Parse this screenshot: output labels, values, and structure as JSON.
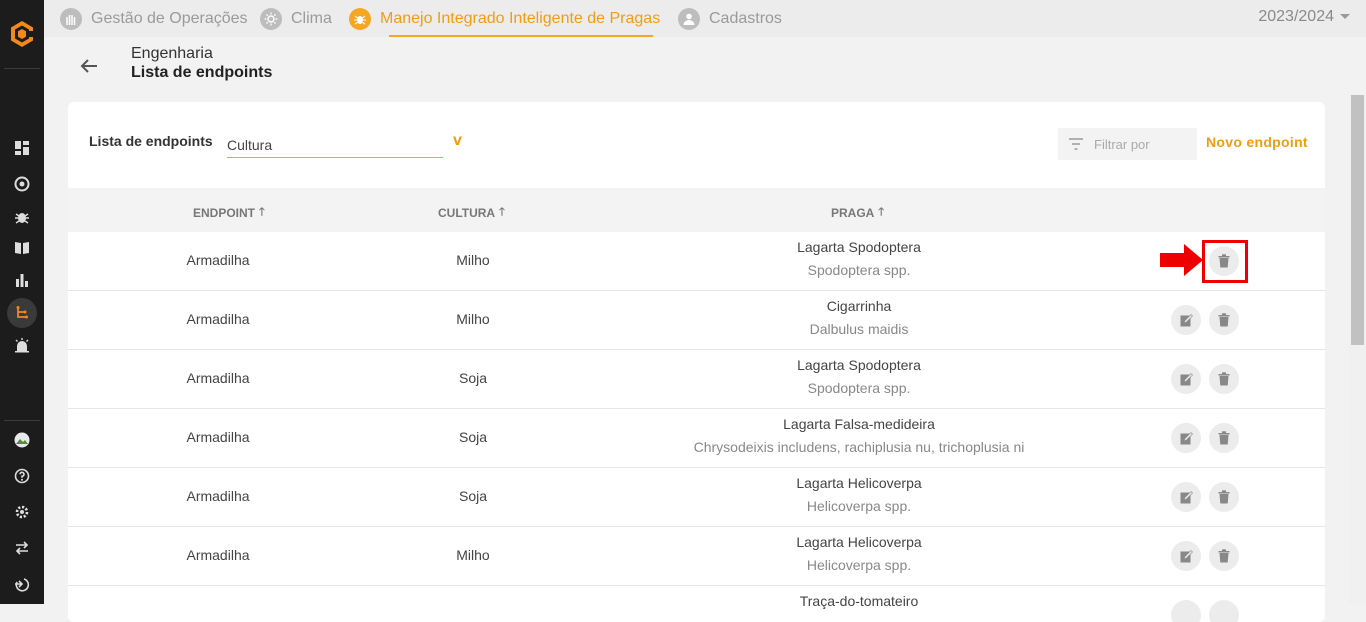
{
  "topbar": {
    "tabs": [
      {
        "label": "Gestão de Operações",
        "icon": "hand-icon"
      },
      {
        "label": "Clima",
        "icon": "sun-icon"
      },
      {
        "label": "Manejo Integrado Inteligente de Pragas",
        "icon": "bug-icon"
      },
      {
        "label": "Cadastros",
        "icon": "user-icon"
      }
    ],
    "season": "2023/2024"
  },
  "header": {
    "breadcrumb_parent": "Engenharia",
    "page_title": "Lista de endpoints"
  },
  "toolbar": {
    "label": "Lista de endpoints",
    "select_value": "Cultura",
    "select_caret": "v",
    "filter_placeholder": "Filtrar por",
    "new_endpoint_label": "Novo endpoint"
  },
  "table": {
    "columns": [
      "ENDPOINT",
      "CULTURA",
      "PRAGA"
    ],
    "rows": [
      {
        "endpoint": "Armadilha",
        "cultura": "Milho",
        "praga": "Lagarta Spodoptera",
        "nome_cientifico": "Spodoptera spp."
      },
      {
        "endpoint": "Armadilha",
        "cultura": "Milho",
        "praga": "Cigarrinha",
        "nome_cientifico": "Dalbulus maidis"
      },
      {
        "endpoint": "Armadilha",
        "cultura": "Soja",
        "praga": "Lagarta Spodoptera",
        "nome_cientifico": "Spodoptera spp."
      },
      {
        "endpoint": "Armadilha",
        "cultura": "Soja",
        "praga": "Lagarta Falsa-medideira",
        "nome_cientifico": "Chrysodeixis includens, rachiplusia nu, trichoplusia ni"
      },
      {
        "endpoint": "Armadilha",
        "cultura": "Soja",
        "praga": "Lagarta Helicoverpa",
        "nome_cientifico": "Helicoverpa spp."
      },
      {
        "endpoint": "Armadilha",
        "cultura": "Milho",
        "praga": "Lagarta Helicoverpa",
        "nome_cientifico": "Helicoverpa spp."
      },
      {
        "endpoint": "",
        "cultura": "",
        "praga": "Traça-do-tomateiro",
        "nome_cientifico": ""
      }
    ]
  },
  "colors": {
    "accent": "#f5a623",
    "highlight": "#ee0000",
    "sidebar": "#1c1c1c"
  }
}
